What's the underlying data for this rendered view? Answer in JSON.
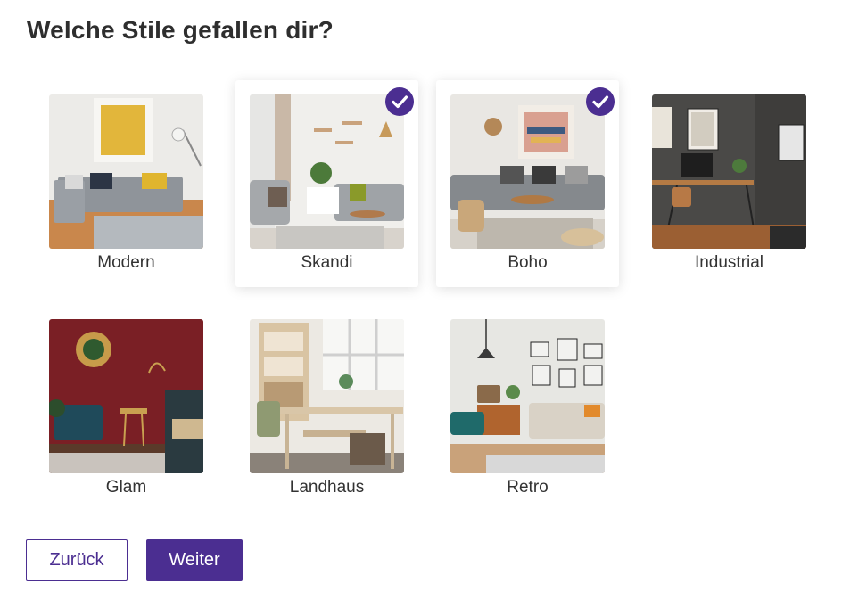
{
  "page": {
    "title": "Welche Stile gefallen dir?"
  },
  "accent_color": "#4b2e91",
  "styles": [
    {
      "label": "Modern",
      "selected": false
    },
    {
      "label": "Skandi",
      "selected": true
    },
    {
      "label": "Boho",
      "selected": true
    },
    {
      "label": "Industrial",
      "selected": false
    },
    {
      "label": "Glam",
      "selected": false
    },
    {
      "label": "Landhaus",
      "selected": false
    },
    {
      "label": "Retro",
      "selected": false
    }
  ],
  "selected_indicator_icon": "checkmark-circle-icon",
  "buttons": {
    "back_label": "Zurück",
    "next_label": "Weiter"
  }
}
